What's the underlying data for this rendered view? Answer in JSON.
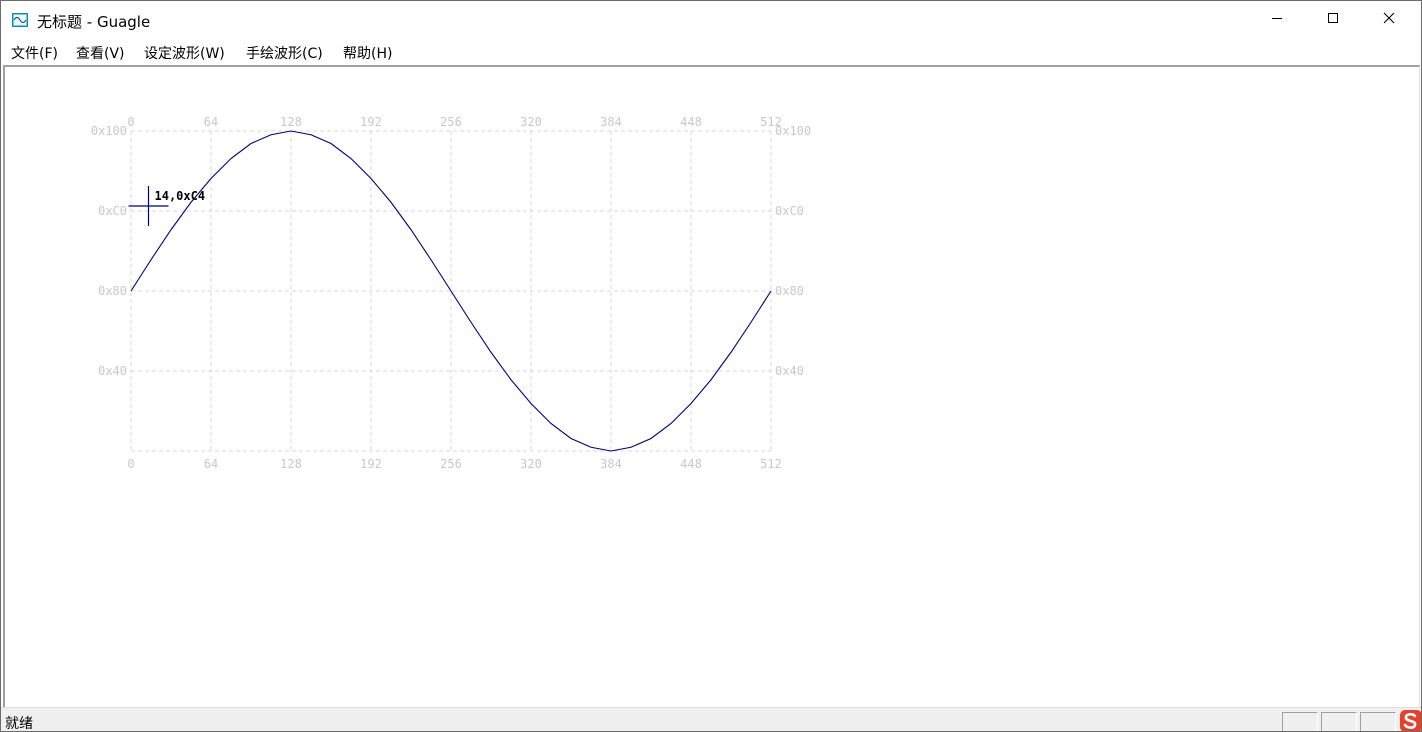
{
  "window": {
    "title": "无标题 - Guagle",
    "app_icon": "waveform-app-icon",
    "controls": [
      "minimize-icon",
      "maximize-icon",
      "close-icon"
    ]
  },
  "menu": {
    "items": [
      {
        "label": "文件(F)"
      },
      {
        "label": "查看(V)"
      },
      {
        "label": "设定波形(W)"
      },
      {
        "label": "手绘波形(C)"
      },
      {
        "label": "帮助(H)"
      }
    ]
  },
  "chart_data": {
    "type": "line",
    "x_ticks": [
      "0",
      "64",
      "128",
      "192",
      "256",
      "320",
      "384",
      "448",
      "512"
    ],
    "y_ticks": [
      "0x100",
      "0xC0",
      "0x80",
      "0x40"
    ],
    "xlim": [
      0,
      512
    ],
    "ylim": [
      0,
      256
    ],
    "grid": true,
    "series": [
      {
        "color": "#000080",
        "x": [
          0,
          16,
          32,
          48,
          64,
          80,
          96,
          112,
          128,
          144,
          160,
          176,
          192,
          208,
          224,
          240,
          256,
          272,
          288,
          304,
          320,
          336,
          352,
          368,
          384,
          400,
          416,
          432,
          448,
          464,
          480,
          496,
          512
        ],
        "y": [
          128,
          153,
          177,
          199,
          218,
          234,
          246,
          253,
          256,
          253,
          246,
          234,
          218,
          199,
          177,
          153,
          128,
          103,
          79,
          57,
          38,
          22,
          10,
          3,
          0,
          3,
          10,
          22,
          38,
          57,
          79,
          103,
          128
        ]
      }
    ],
    "cursor": {
      "x": 14,
      "y": 196,
      "label": "14,0xC4",
      "color": "#000080"
    },
    "grid_color": "#d8d8d8"
  },
  "status": {
    "text": "就绪"
  },
  "tray": {
    "icon": "sogou-ime-icon",
    "color": "#e8402a"
  }
}
